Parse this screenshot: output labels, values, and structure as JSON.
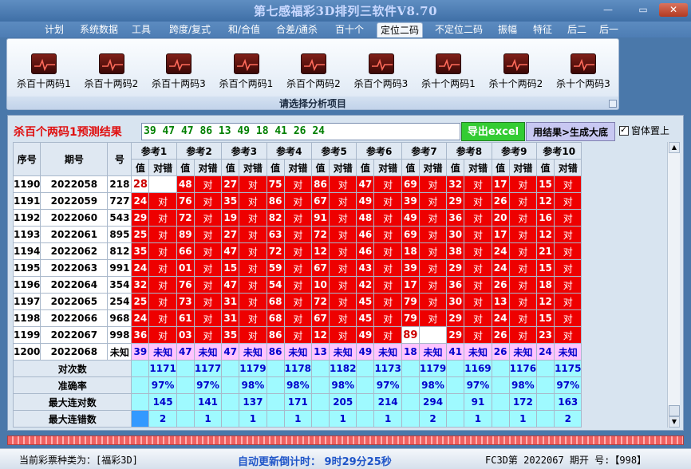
{
  "window": {
    "title": "第七感福彩3D排列三软件V8.70",
    "min": "—",
    "max": "▭",
    "close": "✕"
  },
  "menu": [
    {
      "label": "计划"
    },
    {
      "label": "系统数据"
    },
    {
      "label": "工具"
    },
    {
      "label": "跨度/复式"
    },
    {
      "label": "和/合值"
    },
    {
      "label": "合差/通杀"
    },
    {
      "label": "百十个"
    },
    {
      "label": "定位二码",
      "active": true
    },
    {
      "label": "不定位二码"
    },
    {
      "label": "振幅"
    },
    {
      "label": "特征"
    },
    {
      "label": "后二"
    },
    {
      "label": "后一"
    }
  ],
  "ribbon": {
    "caption": "请选择分析项目",
    "items": [
      {
        "label": "杀百十两码1"
      },
      {
        "label": "杀百十两码2"
      },
      {
        "label": "杀百十两码3"
      },
      {
        "label": "杀百个两码1"
      },
      {
        "label": "杀百个两码2"
      },
      {
        "label": "杀百个两码3"
      },
      {
        "label": "杀十个两码1"
      },
      {
        "label": "杀十个两码2"
      },
      {
        "label": "杀十个两码3"
      }
    ]
  },
  "result": {
    "title": "杀百个两码1预测结果",
    "values": "39 47 47 86 13 49 18 41 26 24",
    "export_label": "导出excel",
    "generate_label": "用结果>生成大底",
    "topmost_label": "窗体置上"
  },
  "table": {
    "headers": {
      "seq": "序号",
      "period": "期号",
      "num": "号",
      "value": "值",
      "correct": "对错",
      "hit_mark": "对",
      "unknown": "未知"
    },
    "refs": [
      "参考1",
      "参考2",
      "参考3",
      "参考4",
      "参考5",
      "参考6",
      "参考7",
      "参考8",
      "参考9",
      "参考10"
    ],
    "rows": [
      {
        "seq": "1190",
        "period": "2022058",
        "num": "218",
        "vals": [
          "28",
          "48",
          "27",
          "75",
          "86",
          "47",
          "69",
          "32",
          "17",
          "15"
        ],
        "hits": [
          0,
          1,
          1,
          1,
          1,
          1,
          1,
          1,
          1,
          1
        ]
      },
      {
        "seq": "1191",
        "period": "2022059",
        "num": "727",
        "vals": [
          "24",
          "76",
          "35",
          "86",
          "67",
          "49",
          "39",
          "29",
          "26",
          "12"
        ],
        "hits": [
          1,
          1,
          1,
          1,
          1,
          1,
          1,
          1,
          1,
          1
        ]
      },
      {
        "seq": "1192",
        "period": "2022060",
        "num": "543",
        "vals": [
          "29",
          "72",
          "19",
          "82",
          "91",
          "48",
          "49",
          "36",
          "20",
          "16"
        ],
        "hits": [
          1,
          1,
          1,
          1,
          1,
          1,
          1,
          1,
          1,
          1
        ]
      },
      {
        "seq": "1193",
        "period": "2022061",
        "num": "895",
        "vals": [
          "25",
          "89",
          "27",
          "63",
          "72",
          "46",
          "69",
          "30",
          "17",
          "12"
        ],
        "hits": [
          1,
          1,
          1,
          1,
          1,
          1,
          1,
          1,
          1,
          1
        ]
      },
      {
        "seq": "1194",
        "period": "2022062",
        "num": "812",
        "vals": [
          "35",
          "66",
          "47",
          "72",
          "12",
          "46",
          "18",
          "38",
          "24",
          "21"
        ],
        "hits": [
          1,
          1,
          1,
          1,
          1,
          1,
          1,
          1,
          1,
          1
        ]
      },
      {
        "seq": "1195",
        "period": "2022063",
        "num": "991",
        "vals": [
          "24",
          "01",
          "15",
          "59",
          "67",
          "43",
          "39",
          "29",
          "24",
          "15"
        ],
        "hits": [
          1,
          1,
          1,
          1,
          1,
          1,
          1,
          1,
          1,
          1
        ]
      },
      {
        "seq": "1196",
        "period": "2022064",
        "num": "354",
        "vals": [
          "32",
          "76",
          "47",
          "54",
          "10",
          "42",
          "17",
          "36",
          "26",
          "18"
        ],
        "hits": [
          1,
          1,
          1,
          1,
          1,
          1,
          1,
          1,
          1,
          1
        ]
      },
      {
        "seq": "1197",
        "period": "2022065",
        "num": "254",
        "vals": [
          "25",
          "73",
          "31",
          "68",
          "72",
          "45",
          "79",
          "30",
          "13",
          "12"
        ],
        "hits": [
          1,
          1,
          1,
          1,
          1,
          1,
          1,
          1,
          1,
          1
        ]
      },
      {
        "seq": "1198",
        "period": "2022066",
        "num": "968",
        "vals": [
          "24",
          "61",
          "31",
          "68",
          "67",
          "45",
          "79",
          "29",
          "24",
          "15"
        ],
        "hits": [
          1,
          1,
          1,
          1,
          1,
          1,
          1,
          1,
          1,
          1
        ]
      },
      {
        "seq": "1199",
        "period": "2022067",
        "num": "998",
        "vals": [
          "36",
          "03",
          "35",
          "86",
          "12",
          "49",
          "89",
          "29",
          "26",
          "23"
        ],
        "hits": [
          1,
          1,
          1,
          1,
          1,
          1,
          0,
          1,
          1,
          1
        ]
      }
    ],
    "future": {
      "seq": "1200",
      "period": "2022068",
      "num": "未知",
      "vals": [
        "39",
        "47",
        "47",
        "86",
        "13",
        "49",
        "18",
        "41",
        "26",
        "24"
      ]
    },
    "stats": [
      {
        "label": "对次数",
        "vals": [
          "1171",
          "1177",
          "1179",
          "1178",
          "1182",
          "1173",
          "1179",
          "1169",
          "1176",
          "1175"
        ]
      },
      {
        "label": "准确率",
        "vals": [
          "97%",
          "97%",
          "98%",
          "98%",
          "98%",
          "97%",
          "98%",
          "97%",
          "98%",
          "97%"
        ]
      },
      {
        "label": "最大连对数",
        "vals": [
          "145",
          "141",
          "137",
          "171",
          "205",
          "214",
          "294",
          "91",
          "172",
          "163"
        ]
      },
      {
        "label": "最大连错数",
        "vals": [
          "2",
          "1",
          "1",
          "1",
          "1",
          "1",
          "2",
          "1",
          "1",
          "2"
        ]
      }
    ]
  },
  "status": {
    "lottery": "当前彩票种类为：[福彩3D]",
    "countdown": "自动更新倒计时：  9时29分25秒",
    "draw": "FC3D第 2022067 期开  号:【998】"
  },
  "colors": {
    "hit": "#ee0000",
    "future": "#ffc4ff",
    "stats": "#9ffaff",
    "export": "#33cc33"
  }
}
